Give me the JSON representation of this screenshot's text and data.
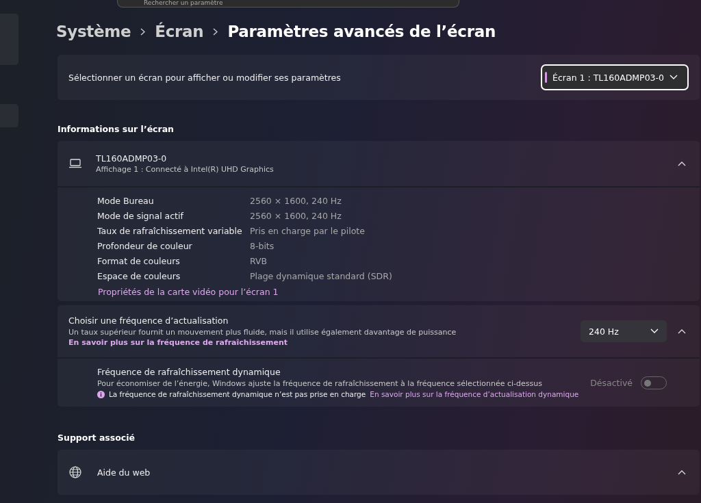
{
  "search": {
    "placeholder": "Rechercher un paramètre"
  },
  "breadcrumb": [
    "Système",
    "Écran",
    "Paramètres avancés de l’écran"
  ],
  "display_select": {
    "label": "Sélectionner un écran pour afficher ou modifier ses paramètres",
    "value": "Écran 1 : TL160ADMP03-0"
  },
  "info_section": {
    "title": "Informations sur l’écran",
    "device": "TL160ADMP03-0",
    "subtitle": "Affichage 1 : Connecté à Intel(R) UHD Graphics",
    "expanded": true,
    "rows": [
      {
        "label": "Mode Bureau",
        "value": "2560 × 1600, 240 Hz"
      },
      {
        "label": "Mode de signal actif",
        "value": "2560 × 1600, 240 Hz"
      },
      {
        "label": "Taux de rafraîchissement variable",
        "value": "Pris en charge par le pilote"
      },
      {
        "label": "Profondeur de couleur",
        "value": "8-bits"
      },
      {
        "label": "Format de couleurs",
        "value": "RVB"
      },
      {
        "label": "Espace de couleurs",
        "value": "Plage dynamique standard (SDR)"
      }
    ],
    "link": "Propriétés de la carte vidéo pour l’écran 1"
  },
  "refresh": {
    "title": "Choisir une fréquence d’actualisation",
    "description": "Un taux supérieur fournit un mouvement plus fluide, mais il utilise également davantage de puissance",
    "link": "En savoir plus sur la fréquence de rafraîchissement",
    "value": "240 Hz",
    "expanded": true,
    "dynamic": {
      "title": "Fréquence de rafraîchissement dynamique",
      "description": "Pour économiser de l’énergie, Windows ajuste la fréquence de rafraîchissement à la fréquence sélectionnée ci-dessus",
      "warning": "La fréquence de rafraîchissement dynamique n’est pas prise en charge",
      "link": "En savoir plus sur la fréquence d’actualisation dynamique",
      "toggle_label": "Désactivé",
      "on": false,
      "disabled": true
    }
  },
  "support": {
    "title": "Support associé",
    "item": "Aide du web",
    "expanded": true
  }
}
